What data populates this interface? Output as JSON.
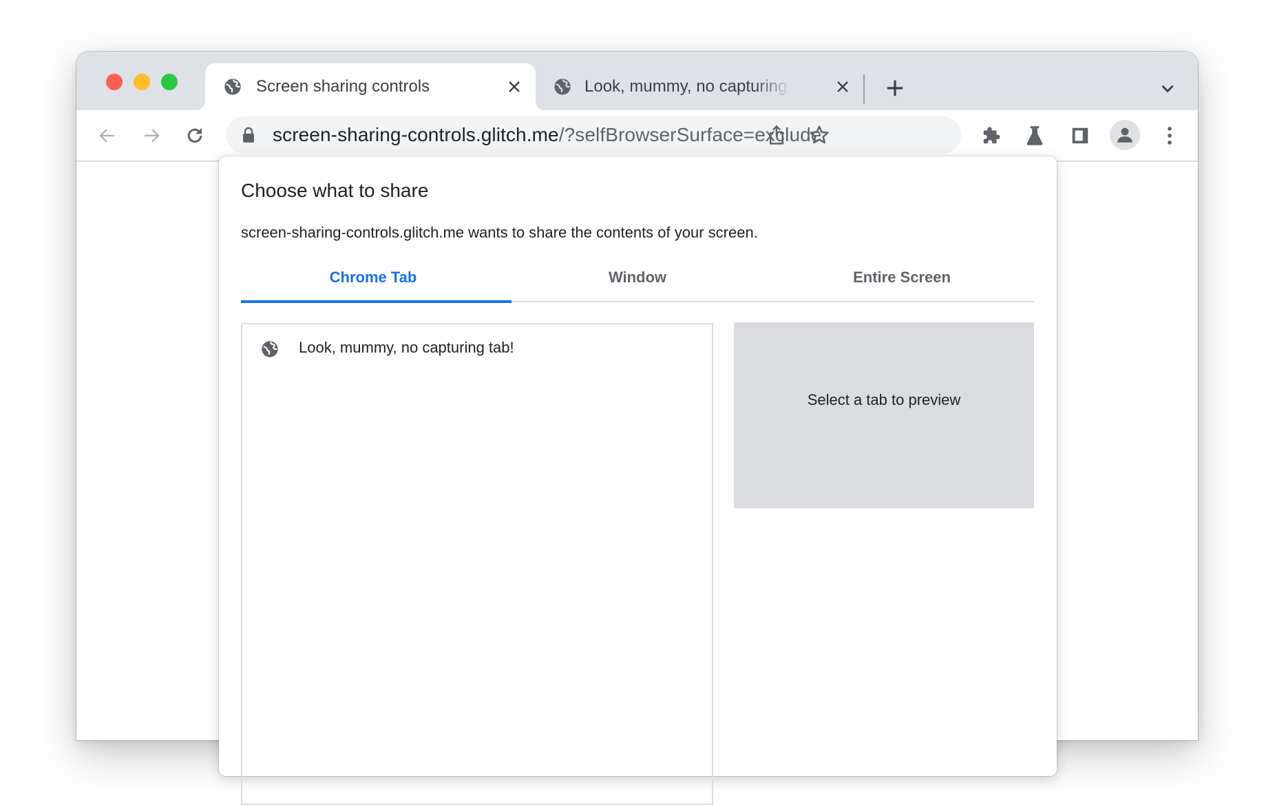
{
  "browser": {
    "tabs": [
      {
        "title": "Screen sharing controls",
        "favicon": "globe-icon",
        "active": true
      },
      {
        "title": "Look, mummy, no capturing tab!",
        "favicon": "globe-icon",
        "active": false
      }
    ],
    "new_tab_icon": "plus-icon",
    "tab_search_icon": "chevron-down-icon",
    "toolbar": {
      "back_icon": "arrow-left-icon",
      "forward_icon": "arrow-right-icon",
      "reload_icon": "reload-icon",
      "omnibox": {
        "security_icon": "lock-icon",
        "url_host": "screen-sharing-controls.glitch.me",
        "url_path": "/?selfBrowserSurface=exclude",
        "share_icon": "share-icon",
        "bookmark_icon": "star-icon"
      },
      "extensions_icon": "puzzle-icon",
      "labs_icon": "flask-icon",
      "side_panel_icon": "side-panel-icon",
      "profile_icon": "person-icon",
      "menu_icon": "kebab-menu-icon"
    }
  },
  "dialog": {
    "title": "Choose what to share",
    "subtitle": "screen-sharing-controls.glitch.me wants to share the contents of your screen.",
    "tabs": [
      {
        "label": "Chrome Tab",
        "selected": true
      },
      {
        "label": "Window",
        "selected": false
      },
      {
        "label": "Entire Screen",
        "selected": false
      }
    ],
    "sources": [
      {
        "label": "Look, mummy, no capturing tab!",
        "icon": "globe-icon"
      }
    ],
    "preview_message": "Select a tab to preview"
  },
  "colors": {
    "accent": "#1a73e8",
    "tabstrip": "#dee1e6",
    "preview_bg": "#dadce0",
    "traffic_close": "#fe5f57",
    "traffic_minimize": "#febc2e",
    "traffic_zoom": "#28c840"
  }
}
